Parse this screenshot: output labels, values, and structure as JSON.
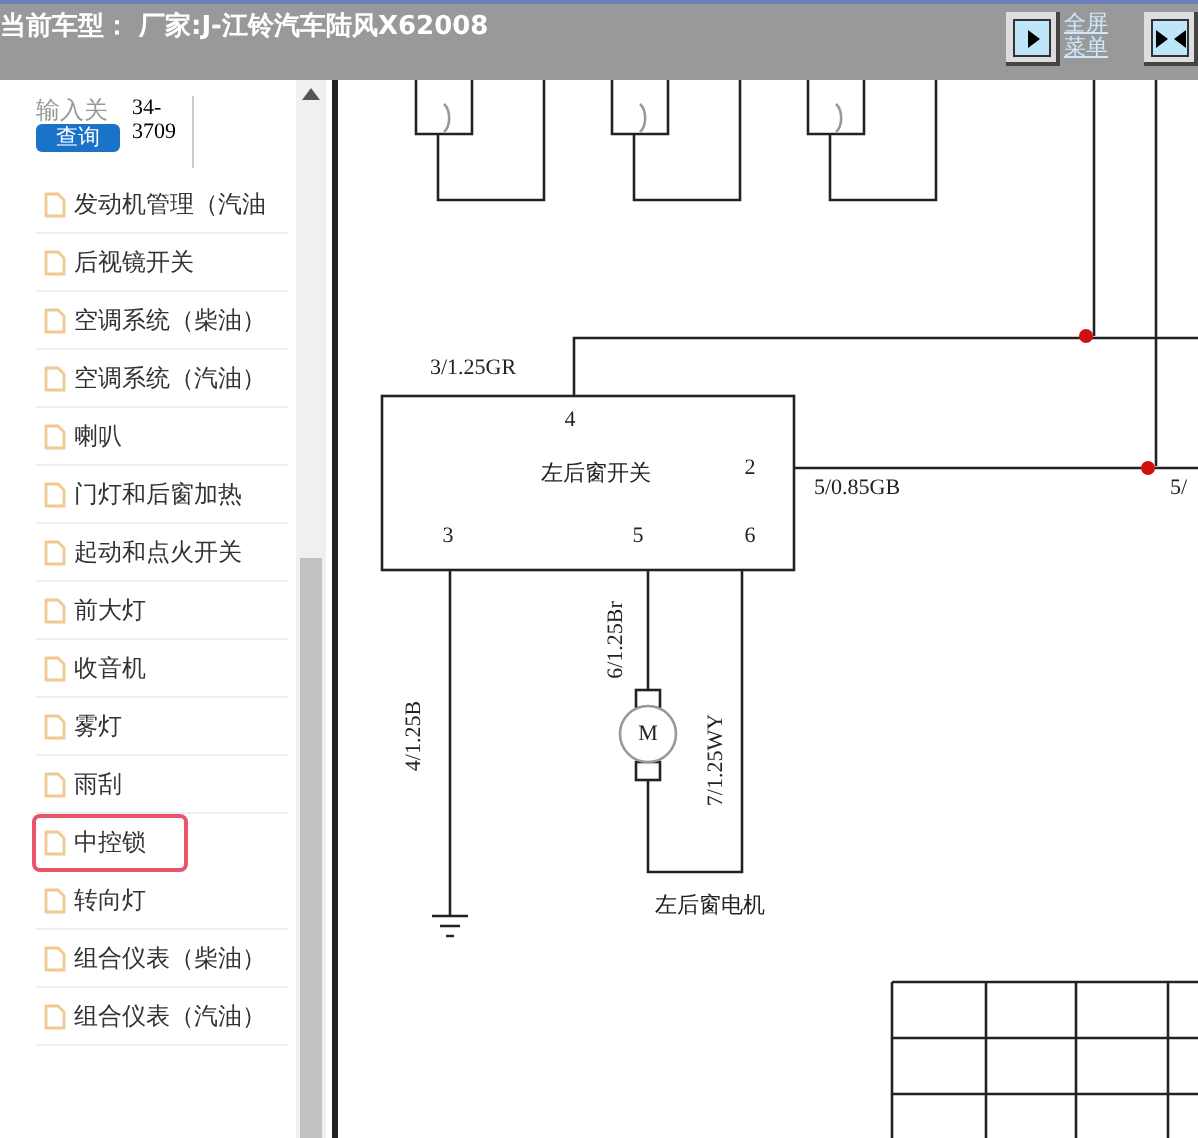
{
  "header": {
    "title": "当前车型：  厂家:J-江铃汽车陆风X62008",
    "buttons": [
      {
        "kind": "fullscreen",
        "label_lines": [
          "全屏",
          "菜单"
        ]
      },
      {
        "kind": "split"
      }
    ]
  },
  "search": {
    "label": "输入关",
    "value": "34-\n3709",
    "button": "查询"
  },
  "sidebar": {
    "items": [
      {
        "label": "发动机管理（汽油",
        "selected": false
      },
      {
        "label": "后视镜开关",
        "selected": false
      },
      {
        "label": "空调系统（柴油）",
        "selected": false
      },
      {
        "label": "空调系统（汽油）",
        "selected": false
      },
      {
        "label": "喇叭",
        "selected": false
      },
      {
        "label": "门灯和后窗加热",
        "selected": false
      },
      {
        "label": "起动和点火开关",
        "selected": false
      },
      {
        "label": "前大灯",
        "selected": false
      },
      {
        "label": "收音机",
        "selected": false
      },
      {
        "label": "雾灯",
        "selected": false
      },
      {
        "label": "雨刮",
        "selected": false
      },
      {
        "label": "中控锁",
        "selected": true
      },
      {
        "label": "转向灯",
        "selected": false
      },
      {
        "label": "组合仪表（柴油）",
        "selected": false
      },
      {
        "label": "组合仪表（汽油）",
        "selected": false
      }
    ]
  },
  "diagram": {
    "labels": [
      "3/1.25GR",
      "4",
      "左后窗开关",
      "2",
      "5/0.85GB",
      "3",
      "5",
      "6",
      "6/1.25Br",
      "M",
      "4/1.25B",
      "7/1.25WY",
      "左后窗电机",
      "5/"
    ]
  }
}
